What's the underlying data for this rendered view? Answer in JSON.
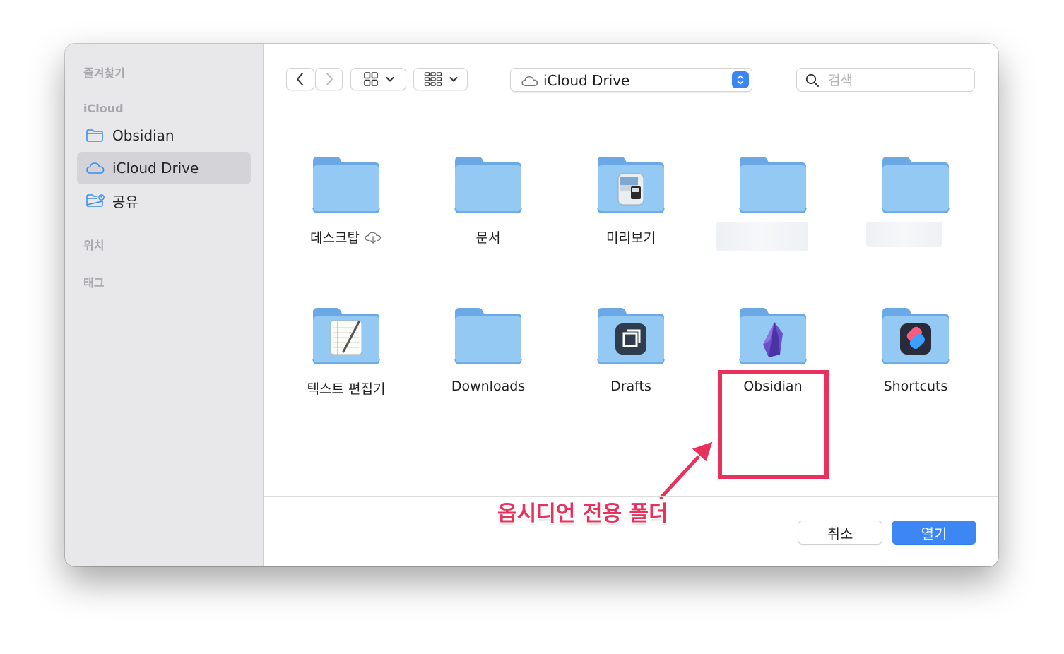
{
  "sidebar": {
    "favorites_label": "즐겨찾기",
    "icloud_label": "iCloud",
    "items": [
      {
        "label": "Obsidian",
        "icon": "folder-icon"
      },
      {
        "label": "iCloud Drive",
        "icon": "cloud-icon",
        "selected": true
      },
      {
        "label": "공유",
        "icon": "shared-folder-icon"
      }
    ],
    "locations_label": "위치",
    "tags_label": "태그"
  },
  "toolbar": {
    "location": "iCloud Drive",
    "search_placeholder": "검색"
  },
  "files": [
    {
      "label": "데스크탑",
      "badge": "cloud-download-icon"
    },
    {
      "label": "문서"
    },
    {
      "label": "미리보기",
      "app_icon": "preview-icon"
    },
    {
      "label": "",
      "blurred": true
    },
    {
      "label": "",
      "blurred": true
    },
    {
      "label": "텍스트 편집기",
      "app_icon": "textedit-icon"
    },
    {
      "label": "Downloads"
    },
    {
      "label": "Drafts",
      "app_icon": "drafts-icon"
    },
    {
      "label": "Obsidian",
      "app_icon": "obsidian-icon",
      "highlighted": true
    },
    {
      "label": "Shortcuts",
      "app_icon": "shortcuts-icon"
    }
  ],
  "annotation": {
    "text": "옵시디언 전용 폴더",
    "color": "#e8315d"
  },
  "footer": {
    "cancel_label": "취소",
    "open_label": "열기"
  },
  "colors": {
    "accent": "#3d87f5",
    "folder": "#8fc4f0",
    "sidebar_bg": "#e8e7ea"
  }
}
